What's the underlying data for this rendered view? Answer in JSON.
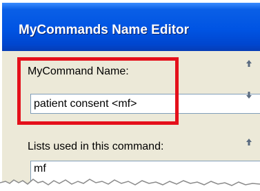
{
  "window": {
    "title": "MyCommands Name Editor"
  },
  "form": {
    "name_label": "MyCommand Name:",
    "name_value": "patient consent <mf>",
    "lists_label": "Lists used in this command:",
    "lists_value": "mf"
  },
  "colors": {
    "titlebar": "#0054e3",
    "dialog_bg": "#ece9d8",
    "highlight": "#e4101b"
  }
}
